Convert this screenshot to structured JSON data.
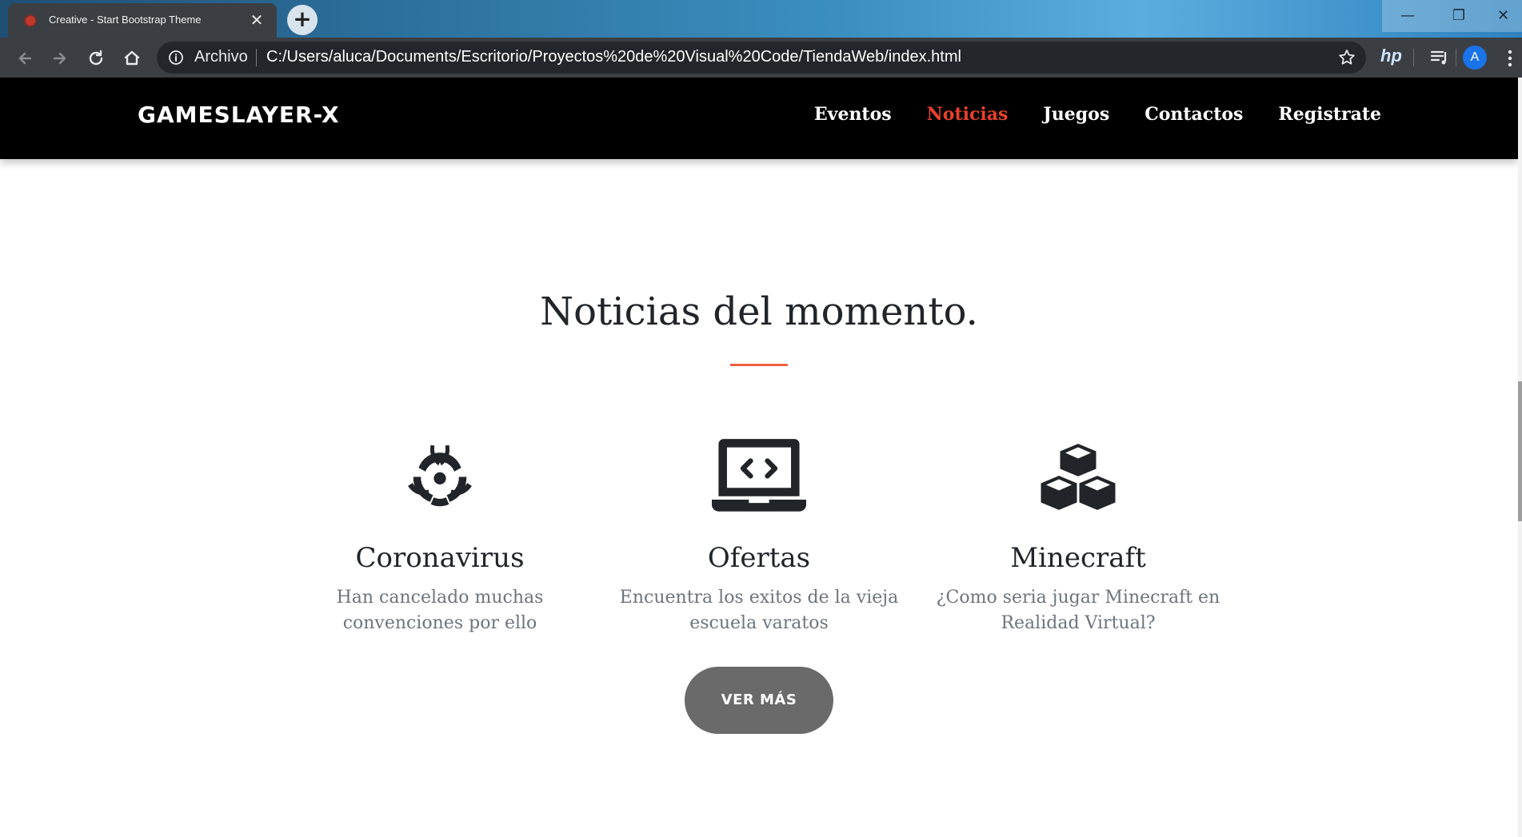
{
  "browser": {
    "tab_title": "Creative - Start Bootstrap Theme",
    "address_scheme": "Archivo",
    "url": "C:/Users/aluca/Documents/Escritorio/Proyectos%20de%20Visual%20Code/TiendaWeb/index.html",
    "extension_label": "hp",
    "avatar_letter": "A"
  },
  "navbar": {
    "brand": "GAMESLAYER-X",
    "links": [
      {
        "label": "Eventos",
        "active": false
      },
      {
        "label": "Noticias",
        "active": true
      },
      {
        "label": "Juegos",
        "active": false
      },
      {
        "label": "Contactos",
        "active": false
      },
      {
        "label": "Registrate",
        "active": false
      }
    ],
    "active_color": "#e8402a"
  },
  "section": {
    "title": "Noticias del momento.",
    "divider_color": "#f05f40",
    "cards": [
      {
        "icon": "biohazard-icon",
        "title": "Coronavirus",
        "text": "Han cancelado muchas convenciones por ello"
      },
      {
        "icon": "laptop-code-icon",
        "title": "Ofertas",
        "text": "Encuentra los exitos de la vieja escuela varatos"
      },
      {
        "icon": "cubes-icon",
        "title": "Minecraft",
        "text": "¿Como seria jugar Minecraft en Realidad Virtual?"
      }
    ],
    "more_button": "VER MÁS"
  }
}
